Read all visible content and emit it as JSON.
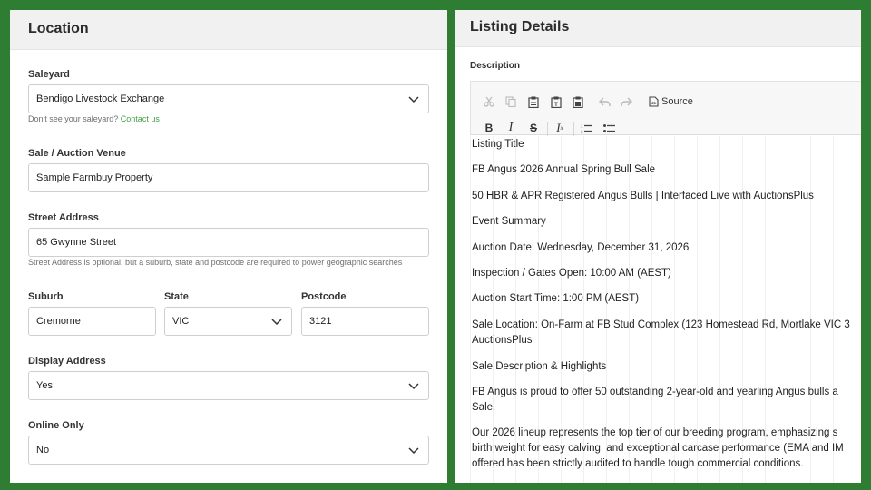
{
  "location": {
    "title": "Location",
    "saleyard": {
      "label": "Saleyard",
      "value": "Bendigo Livestock Exchange",
      "help": "Don't see your saleyard?",
      "help_link": "Contact us"
    },
    "venue": {
      "label": "Sale / Auction Venue",
      "value": "Sample Farmbuy Property"
    },
    "street": {
      "label": "Street Address",
      "value": "65 Gwynne Street",
      "help": "Street Address is optional, but a suburb, state and postcode are required to power geographic searches"
    },
    "suburb": {
      "label": "Suburb",
      "value": "Cremorne"
    },
    "state": {
      "label": "State",
      "value": "VIC"
    },
    "postcode": {
      "label": "Postcode",
      "value": "3121"
    },
    "display_address": {
      "label": "Display Address",
      "value": "Yes"
    },
    "online_only": {
      "label": "Online Only",
      "value": "No"
    }
  },
  "listing": {
    "title": "Listing Details",
    "description_label": "Description",
    "toolbar": {
      "source_label": "Source",
      "icons": [
        "cut-icon",
        "copy-icon",
        "paste-icon",
        "paste-text-icon",
        "paste-word-icon",
        "undo-icon",
        "redo-icon",
        "source-icon",
        "bold-icon",
        "italic-icon",
        "strike-icon",
        "remove-format-icon",
        "numbered-list-icon",
        "bulleted-list-icon"
      ]
    },
    "paragraphs": [
      "Listing Title",
      "FB Angus 2026 Annual Spring Bull Sale",
      "50 HBR & APR Registered Angus Bulls | Interfaced Live with AuctionsPlus",
      "Event Summary",
      "Auction Date: Wednesday, December 31, 2026",
      "Inspection / Gates Open: 10:00 AM (AEST)",
      "Auction Start Time: 1:00 PM (AEST)",
      "Sale Location: On-Farm at FB Stud Complex (123 Homestead Rd, Mortlake VIC 3",
      "AuctionsPlus",
      "Sale Description & Highlights",
      "FB Angus is proud to offer 50 outstanding 2-year-old and yearling Angus bulls a",
      "Sale.",
      "Our 2026 lineup represents the top tier of our breeding program, emphasizing s",
      "birth weight for easy calving, and exceptional carcase performance (EMA and IM",
      "offered has been strictly audited to handle tough commercial conditions."
    ]
  },
  "colors": {
    "frame": "#2e7d32",
    "link": "#43a047"
  }
}
